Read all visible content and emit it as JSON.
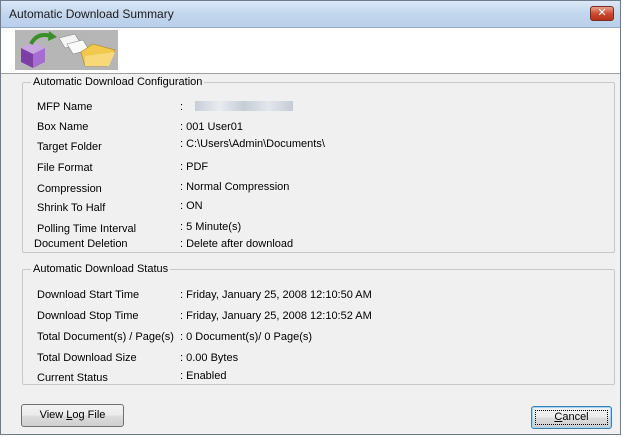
{
  "window": {
    "title": "Automatic Download Summary",
    "close_label": "✕"
  },
  "config": {
    "legend": "Automatic Download Configuration",
    "rows": [
      {
        "label": "MFP Name",
        "value": ":"
      },
      {
        "label": "Box Name",
        "value": ": 001 User01"
      },
      {
        "label": "Target Folder",
        "value": ": C:\\Users\\Admin\\Documents\\"
      },
      {
        "label": "File Format",
        "value": ": PDF"
      },
      {
        "label": "Compression",
        "value": ": Normal Compression"
      },
      {
        "label": "Shrink To Half",
        "value": ": ON"
      },
      {
        "label": "Polling Time Interval",
        "value": ": 5 Minute(s)"
      },
      {
        "label": "Document Deletion",
        "value": ": Delete after download"
      }
    ]
  },
  "status": {
    "legend": "Automatic Download Status",
    "rows": [
      {
        "label": "Download Start Time",
        "value": ": Friday, January 25, 2008 12:10:50 AM"
      },
      {
        "label": "Download Stop Time",
        "value": ": Friday, January 25, 2008 12:10:52 AM"
      },
      {
        "label": "Total Document(s) / Page(s)",
        "value": ": 0 Document(s)/ 0 Page(s)"
      },
      {
        "label": "Total Download Size",
        "value": ": 0.00 Bytes"
      },
      {
        "label": "Current Status",
        "value": ": Enabled"
      }
    ]
  },
  "buttons": {
    "view_log_prefix": "View ",
    "view_log_mnemonic": "L",
    "view_log_suffix": "og File",
    "cancel_mnemonic": "C",
    "cancel_suffix": "ancel"
  },
  "icons": {
    "banner": "document-transfer-icon",
    "close": "close-icon"
  }
}
